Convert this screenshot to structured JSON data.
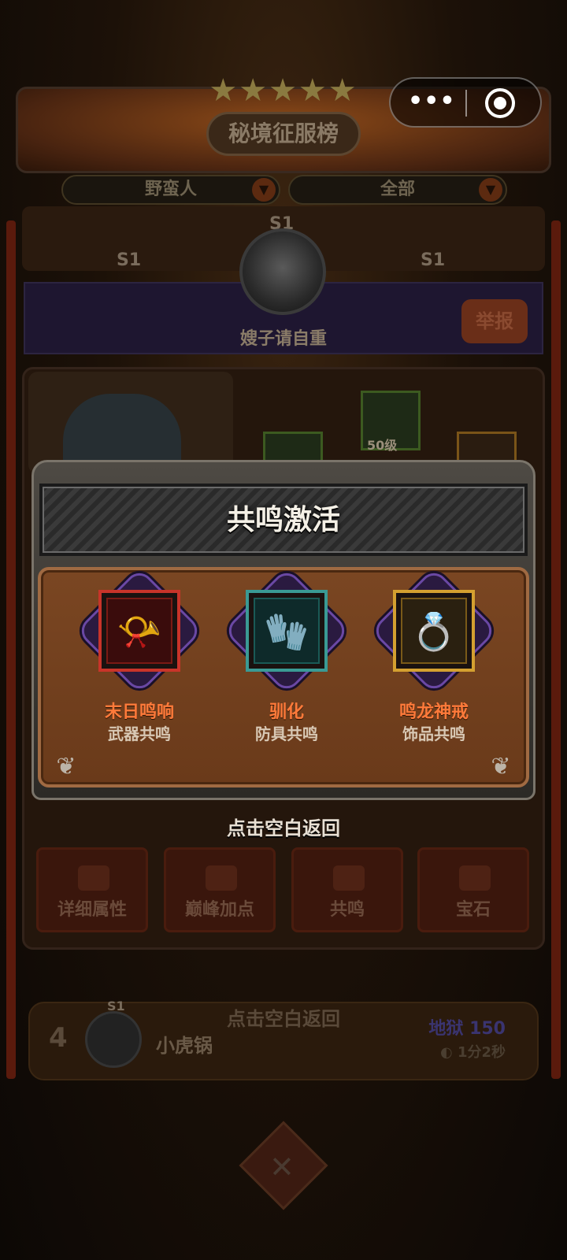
{
  "leaderboard": {
    "title": "秘境征服榜",
    "class_filter": "野蛮人",
    "scope_filter": "全部",
    "season_tags": [
      "S1",
      "S1",
      "S1"
    ],
    "top_player_name": "嫂子请自重",
    "report_label": "举报"
  },
  "hero_panel": {
    "level_badge": "50级",
    "actions": [
      {
        "label": "详细属性"
      },
      {
        "label": "巅峰加点"
      },
      {
        "label": "共鸣"
      },
      {
        "label": "宝石"
      }
    ]
  },
  "ranking_row": {
    "rank": "4",
    "season_tag": "S1",
    "name": "小虎锅",
    "level": "地狱 150",
    "time": "1分2秒"
  },
  "capsule": {
    "more_icon": "more-dots-icon",
    "close_icon": "target-close-icon"
  },
  "modal": {
    "title": "共鸣激活",
    "items": [
      {
        "name": "末日鸣响",
        "type": "武器共鸣",
        "icon": "horn-icon",
        "frame_color": "#c8342a",
        "inner_color": "#3a0c0c"
      },
      {
        "name": "驯化",
        "type": "防具共鸣",
        "icon": "gauntlet-icon",
        "frame_color": "#3a9a94",
        "inner_color": "#0e2a2a"
      },
      {
        "name": "鸣龙神戒",
        "type": "饰品共鸣",
        "icon": "dragon-ring-icon",
        "frame_color": "#d4a030",
        "inner_color": "#2a2010"
      }
    ],
    "dismiss_hint": "点击空白返回"
  },
  "colors": {
    "item_name": "#ff7a3a",
    "item_type": "#d8c8b4",
    "modal_body": "#7a4622"
  }
}
